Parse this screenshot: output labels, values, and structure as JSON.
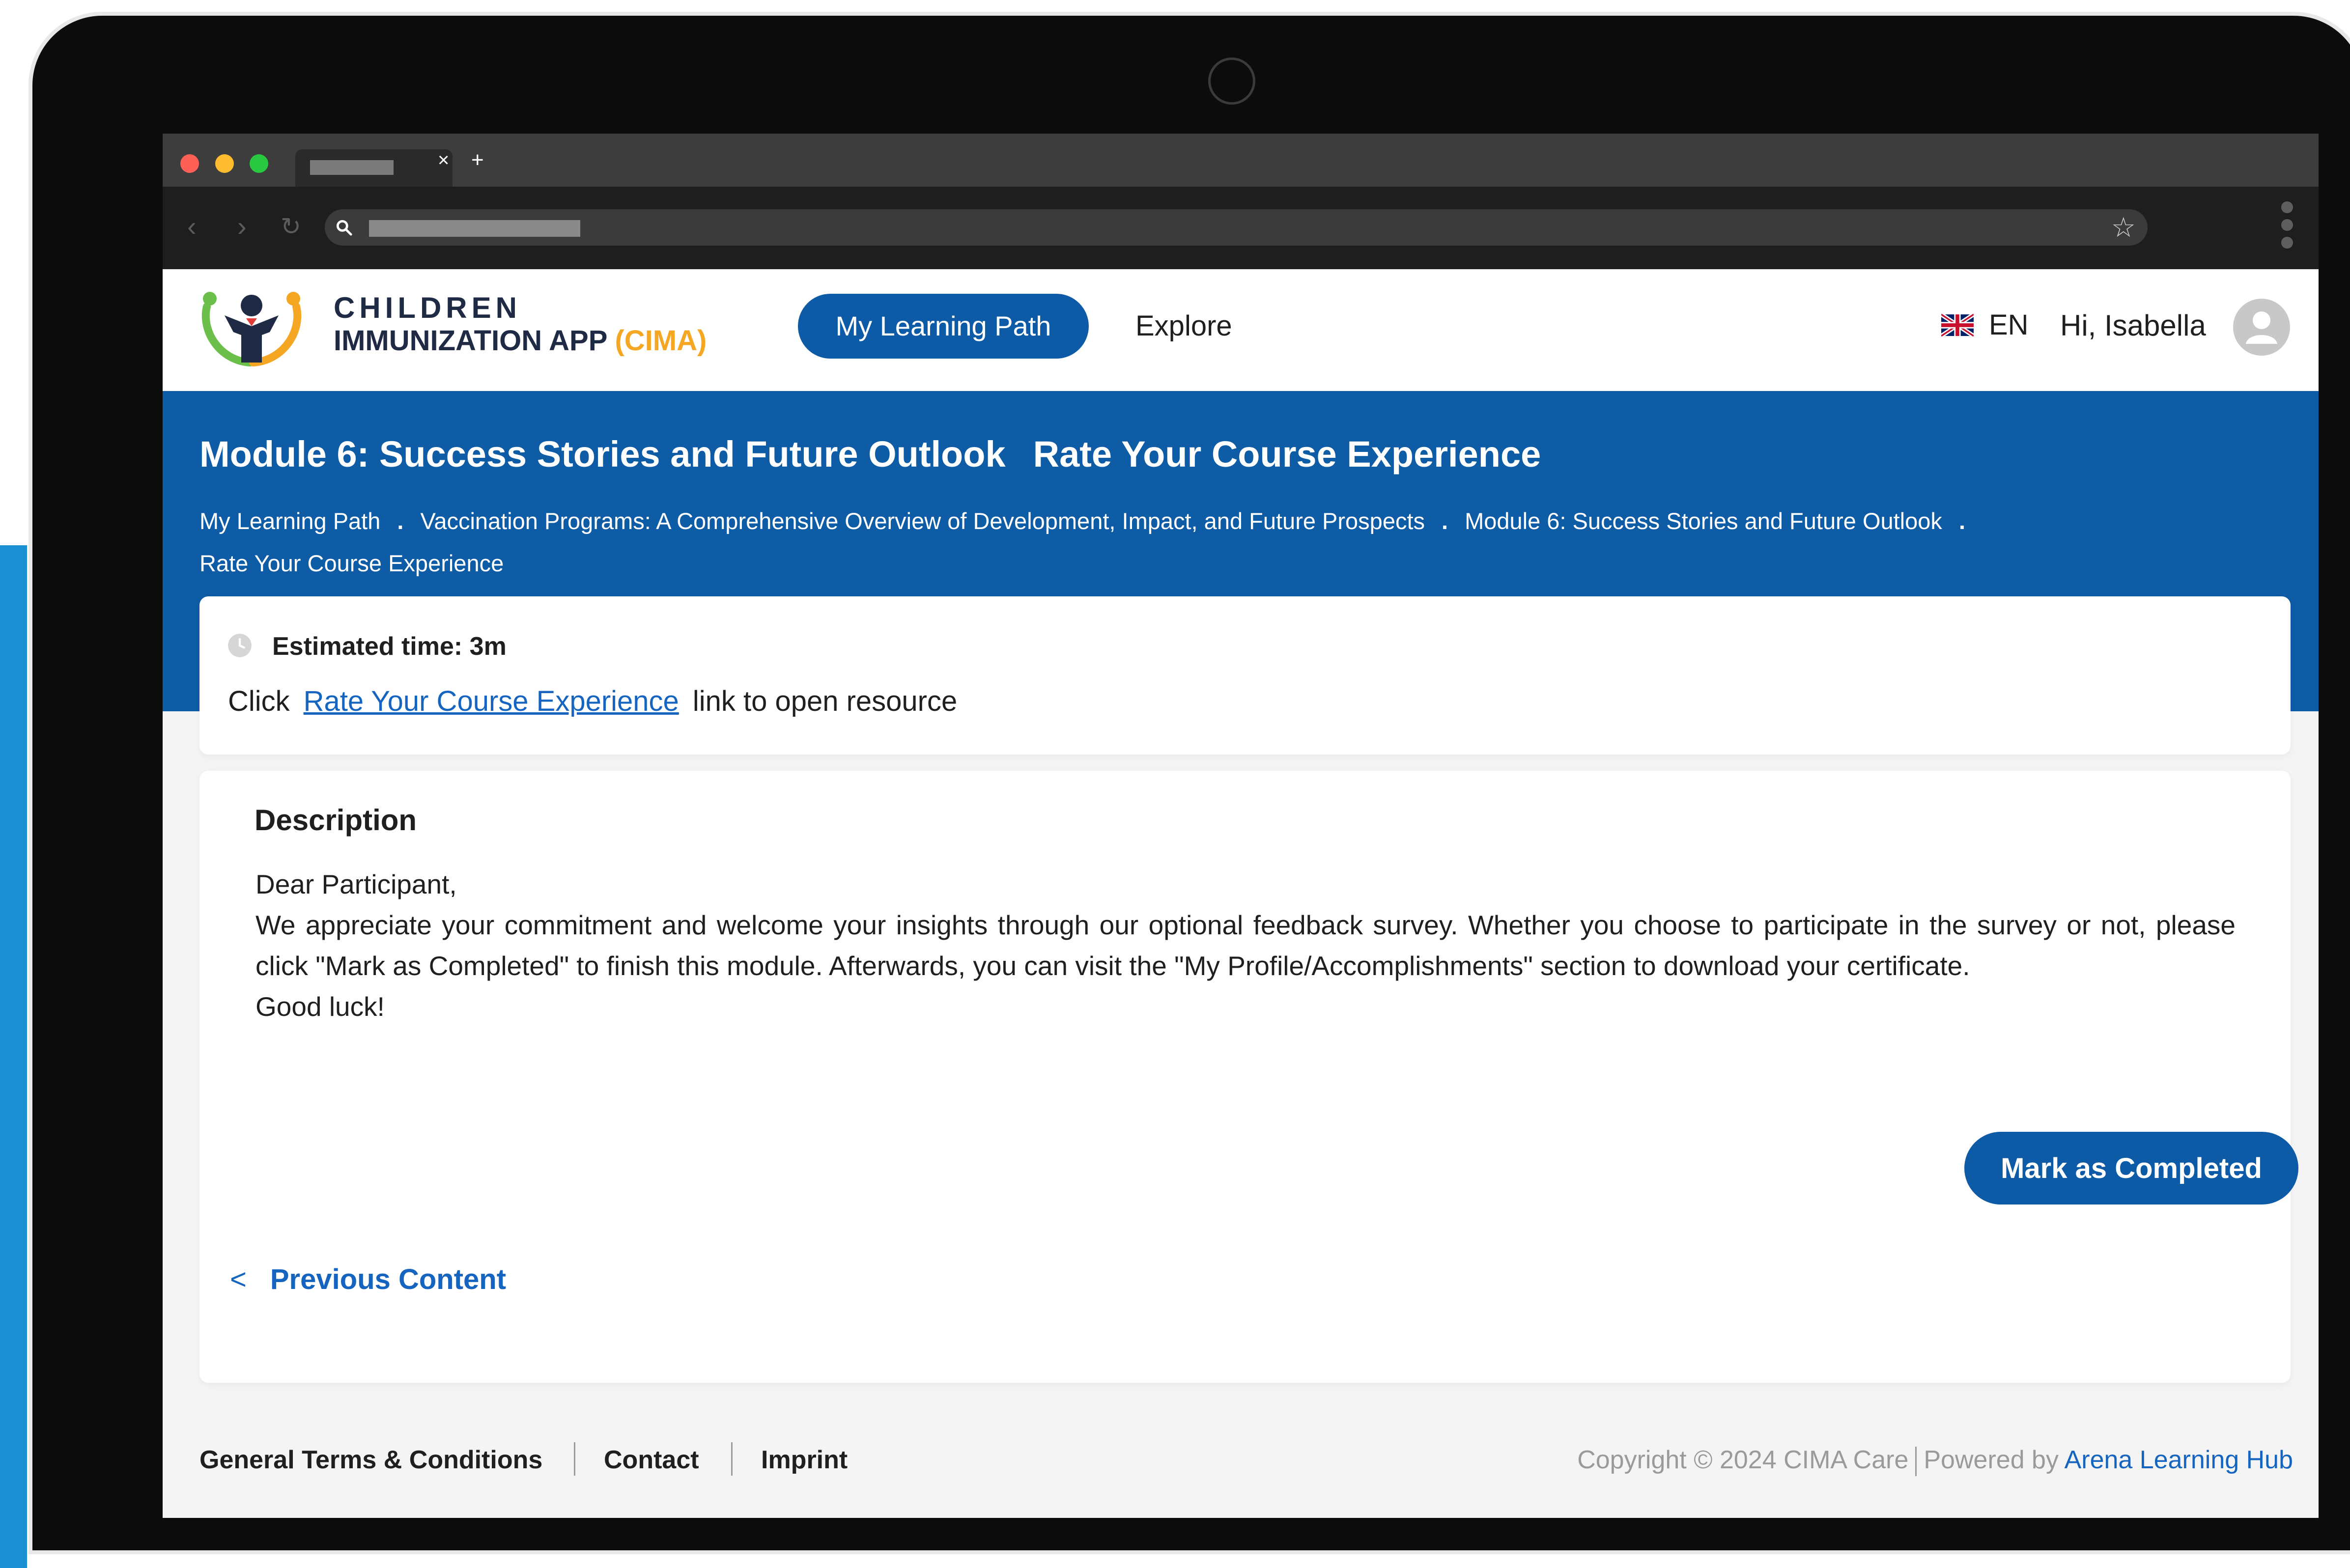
{
  "app": {
    "logo_line1": "CHILDREN",
    "logo_line2": "IMMUNIZATION APP",
    "logo_accent": "(CIMA)",
    "nav": {
      "my_learning_path": "My Learning Path",
      "explore": "Explore"
    },
    "language": "EN",
    "greeting": "Hi, Isabella"
  },
  "banner": {
    "module_title": "Module 6: Success Stories and Future Outlook",
    "page_title": "Rate Your Course Experience",
    "breadcrumb": [
      "My Learning Path",
      "Vaccination Programs: A Comprehensive Overview of Development, Impact, and Future Prospects",
      "Module 6: Success Stories and Future Outlook",
      "Rate Your Course Experience"
    ],
    "breadcrumb_separator": "."
  },
  "resource": {
    "estimated_time": "Estimated time: 3m",
    "click_prefix": "Click",
    "link_text": "Rate Your Course Experience",
    "click_suffix": "link to open resource"
  },
  "description": {
    "title": "Description",
    "greeting": "Dear Participant,",
    "body": "We appreciate your commitment and welcome your insights through our optional feedback survey. Whether you choose to participate in the survey or not, please click \"Mark as Completed\" to finish this module. Afterwards, you can visit the \"My Profile/Accomplishments\" section to download your certificate.",
    "closing": "Good luck!"
  },
  "actions": {
    "mark_completed": "Mark as Completed",
    "previous_content": "Previous Content"
  },
  "footer": {
    "terms": "General Terms & Conditions",
    "contact": "Contact",
    "imprint": "Imprint",
    "copyright": "Copyright © 2024 CIMA Care",
    "powered_by": "Powered by",
    "powered_brand": "Arena Learning Hub"
  },
  "colors": {
    "primary_blue": "#0e5ca6",
    "link_blue": "#1565c0",
    "accent_orange": "#f5a623",
    "accent_green": "#6cbf4b"
  },
  "icons": {
    "clock": "clock-icon",
    "avatar": "user-avatar-icon",
    "flag": "uk-flag-icon",
    "chevron": "chevron-left-icon",
    "star": "star-icon"
  }
}
